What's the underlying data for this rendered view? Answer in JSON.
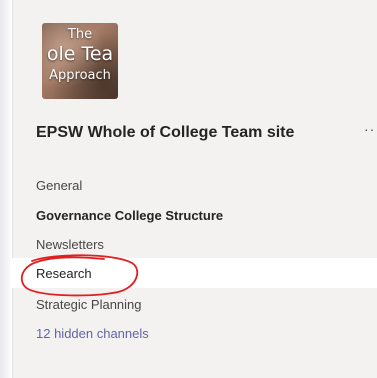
{
  "team": {
    "avatar_text": [
      "The",
      "ole Tea",
      "Approach"
    ],
    "name": "EPSW Whole of College Team site",
    "more_label": "···"
  },
  "channels": [
    {
      "label": "General"
    },
    {
      "label": "Governance College Structure"
    },
    {
      "label": "Newsletters"
    },
    {
      "label": "Research"
    },
    {
      "label": "Strategic Planning"
    }
  ],
  "hidden_channels": {
    "label": "12 hidden channels"
  },
  "colors": {
    "panel_bg": "#f3f2f1",
    "selected_bg": "#ffffff",
    "link": "#6264a7",
    "annotation": "#e02020"
  }
}
